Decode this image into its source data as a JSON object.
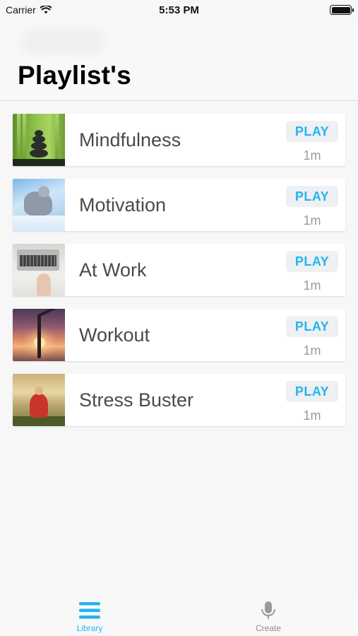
{
  "status_bar": {
    "carrier": "Carrier",
    "time": "5:53 PM",
    "icons": [
      "wifi-icon",
      "battery-icon"
    ]
  },
  "header": {
    "title": "Playlist's"
  },
  "playlists": [
    {
      "title": "Mindfulness",
      "action": "PLAY",
      "duration": "1m",
      "thumbnail": "zen-stones-bamboo"
    },
    {
      "title": "Motivation",
      "action": "PLAY",
      "duration": "1m",
      "thumbnail": "wolf-in-snow"
    },
    {
      "title": "At Work",
      "action": "PLAY",
      "duration": "1m",
      "thumbnail": "laptop-desk"
    },
    {
      "title": "Workout",
      "action": "PLAY",
      "duration": "1m",
      "thumbnail": "yoga-sunset"
    },
    {
      "title": "Stress Buster",
      "action": "PLAY",
      "duration": "1m",
      "thumbnail": "meditating-monk"
    }
  ],
  "tab_bar": {
    "tabs": [
      {
        "label": "Library",
        "icon": "list-icon",
        "selected": true
      },
      {
        "label": "Create",
        "icon": "microphone-icon",
        "selected": false
      }
    ]
  },
  "colors": {
    "accent": "#23b5ef",
    "play_button_bg": "#eef0f3",
    "inactive_tab": "#8e8e8e",
    "background": "#f7f7f7"
  }
}
